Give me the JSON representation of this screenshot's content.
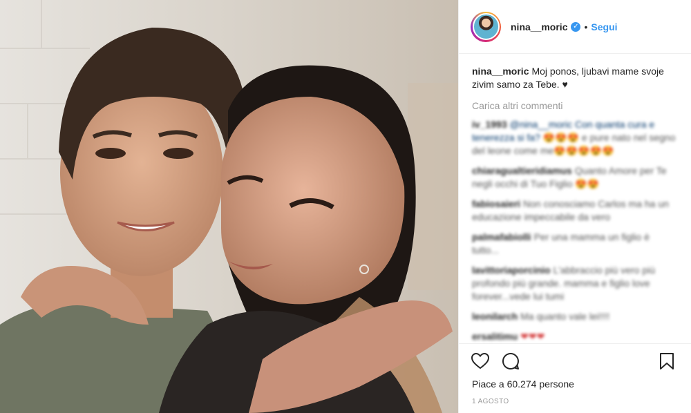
{
  "post": {
    "photo_alt": "photo",
    "username": "nina__moric",
    "verified_icon": "verified-badge-icon",
    "follow_label": "Segui",
    "separator": "•",
    "caption_user": "nina__moric",
    "caption_text": "Moj ponos, ljubavi mame svoje zivim samo za Tebe. ♥",
    "load_more": "Carica altri commenti",
    "comments": [
      {
        "user": "iv_1993",
        "text": "@nina__moric Con quanta cura e tenerezza si fa?",
        "emoji": "😍😍😍",
        "tail": "e pure nato nel segno del leone come me",
        "emoji2": "😍😍😍😍😍"
      },
      {
        "user": "chiaragualtieridiamus",
        "text": "Quanto Amore per Te negli occhi di Tuo Figlio",
        "emoji": "😍😍"
      },
      {
        "user": "fabiosaieri",
        "text": "Non conosciamo Carlos ma ha un educazione impeccabile da vero"
      },
      {
        "user": "palmafabiolli",
        "text": "Per una mamma un figlio è tutto..."
      },
      {
        "user": "lavittoriaporcinio",
        "text": "L'abbraccio più vero più profondo più grande. mamma e figlio love forever...vede lui tumi"
      },
      {
        "user": "leonilarch",
        "text": "Ma quanto vale lei!!!!"
      },
      {
        "user": "ersalitimu",
        "heart": "❤❤❤"
      }
    ],
    "likes_prefix": "Piace a",
    "likes_count": "60.274",
    "likes_suffix": "persone",
    "date": "1 AGOSTO",
    "icons": {
      "like": "heart-outline-icon",
      "comment": "comment-bubble-icon",
      "save": "bookmark-icon"
    }
  }
}
